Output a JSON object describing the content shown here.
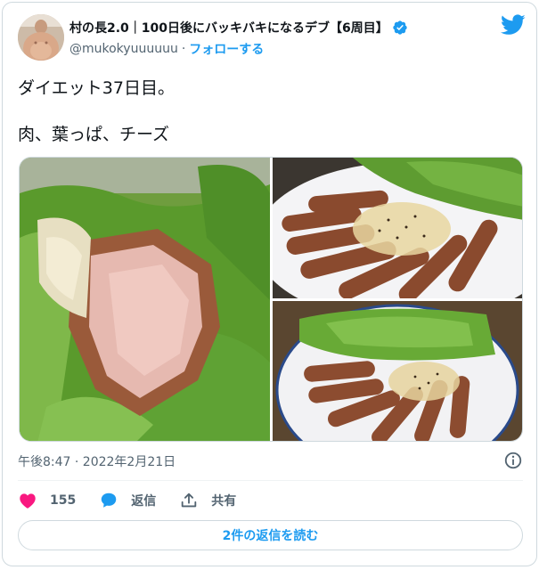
{
  "user": {
    "display_name": "村の長2.0｜100日後にバッキバキになるデブ【6周目】",
    "handle": "@mukokyuuuuuu",
    "separator": "·",
    "follow_label": "フォローする"
  },
  "tweet": {
    "text": "ダイエット37日目。\n\n肉、葉っぱ、チーズ",
    "timestamp": "午後8:47 · 2022年2月21日"
  },
  "actions": {
    "like_count": "155",
    "reply_label": "返信",
    "share_label": "共有"
  },
  "replies_button_label": "2件の返信を読む",
  "icons": {
    "brand": "twitter-bird-icon",
    "verified": "verified-badge-icon",
    "info": "info-icon",
    "like": "heart-icon",
    "reply": "speech-bubble-icon",
    "share": "share-upload-icon"
  },
  "colors": {
    "accent": "#1d9bf0",
    "like": "#f91880",
    "text": "#0f1419",
    "secondary": "#536471"
  }
}
